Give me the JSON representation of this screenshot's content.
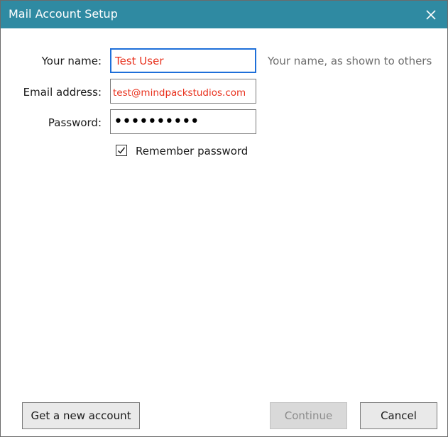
{
  "window": {
    "title": "Mail Account Setup",
    "close_glyph": "✕"
  },
  "form": {
    "name_label": "Your name:",
    "name_value": "Test User",
    "name_hint": "Your name, as shown to others",
    "email_label": "Email address:",
    "email_value": "test@mindpackstudios.com",
    "password_label": "Password:",
    "password_value": "••••••••••",
    "remember_label": "Remember password",
    "remember_checked": true
  },
  "buttons": {
    "get_new_account": "Get a new account",
    "continue": "Continue",
    "cancel": "Cancel"
  },
  "colors": {
    "titlebar": "#2f8aa2",
    "input_text": "#e8301c",
    "focus_border": "#1e6fd9",
    "hint_text": "#6d6d6d"
  },
  "icons": {
    "close": "close-icon",
    "check": "check-icon"
  }
}
